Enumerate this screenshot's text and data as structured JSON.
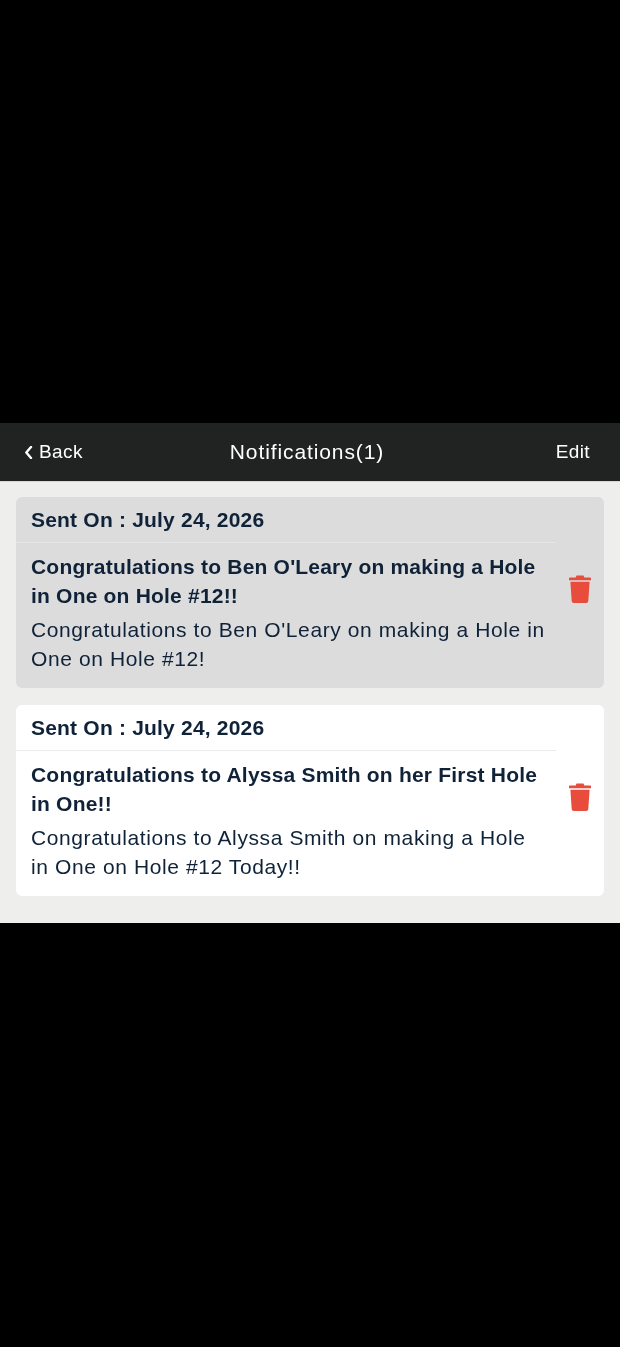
{
  "nav": {
    "back": "Back",
    "title": "Notifications(1)",
    "edit": "Edit"
  },
  "notifications": [
    {
      "sent_on": "Sent On : July 24, 2026",
      "title": "Congratulations to Ben O'Leary on making a Hole in One on Hole #12!!",
      "body": "Congratulations to Ben O'Leary on making a Hole in One on Hole #12!",
      "unread": true
    },
    {
      "sent_on": "Sent On : July 24, 2026",
      "title": "Congratulations to Alyssa Smith on her First Hole in One!!",
      "body": "Congratulations to Alyssa Smith on making a Hole in One on Hole #12 Today!!",
      "unread": false
    }
  ]
}
